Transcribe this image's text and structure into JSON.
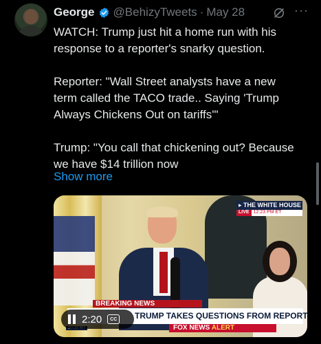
{
  "tweet": {
    "author_name": "George",
    "handle": "@BehizyTweets",
    "separator": "·",
    "date": "May 28",
    "more_label": "···",
    "lines": [
      "WATCH: Trump just hit a home run with his",
      "response to a reporter's snarky question.",
      "",
      "Reporter: \"Wall Street analysts have a new",
      "term called the TACO trade.. Saying 'Trump",
      "Always Chickens Out on tariffs'\"",
      "",
      "Trump: \"You call that chickening out? Because",
      "we have $14 trillion now"
    ],
    "show_more": "Show more"
  },
  "video": {
    "white_house_label": "▸ THE WHITE HOUSE",
    "live_label": "LIVE",
    "clock": "12:23 PM ET",
    "breaking_label": "BREAKING NEWS",
    "headline": "TRUMP TAKES QUESTIONS FROM REPORTERS",
    "fox_label": "FOX NEWS",
    "fox_alert": "ALERT",
    "corner_time": "10:33 MT",
    "elapsed": "2:20",
    "cc_label": "CC"
  },
  "colors": {
    "accent": "#1d9bf0",
    "background": "#000000",
    "text": "#e7e9ea",
    "muted": "#71767b"
  },
  "icons": [
    "verified-badge-icon",
    "grok-icon",
    "more-icon",
    "pause-icon",
    "closed-captions-icon"
  ]
}
